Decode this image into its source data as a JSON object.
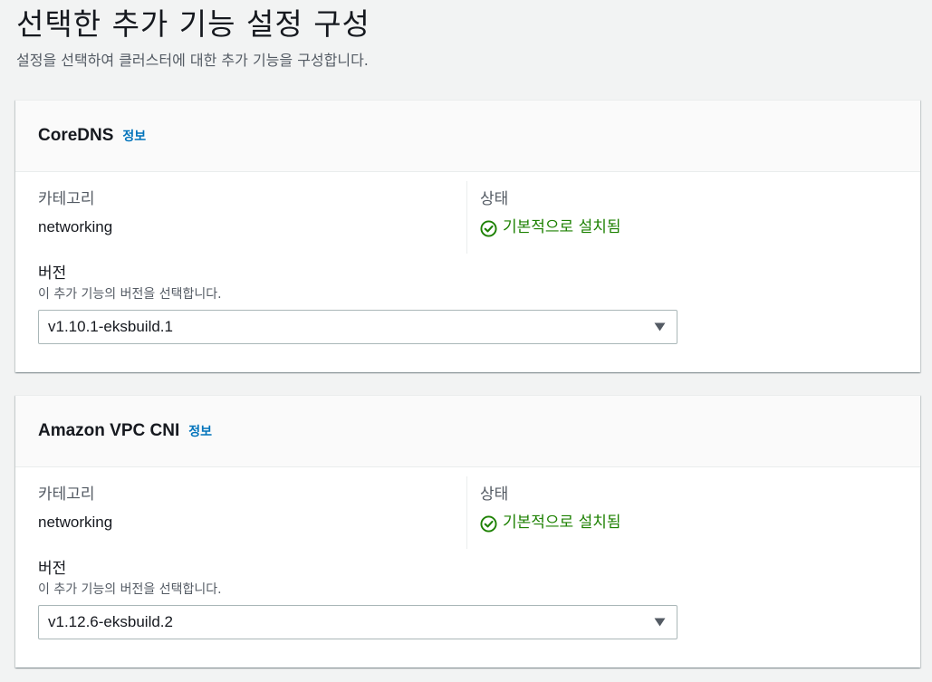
{
  "header": {
    "title": "선택한 추가 기능 설정 구성",
    "description": "설정을 선택하여 클러스터에 대한 추가 기능을 구성합니다."
  },
  "addons": [
    {
      "name": "CoreDNS",
      "info_link": "정보",
      "category_label": "카테고리",
      "category_value": "networking",
      "status_label": "상태",
      "status_value": "기본적으로 설치됨",
      "version_label": "버전",
      "version_description": "이 추가 기능의 버전을 선택합니다.",
      "version_selected": "v1.10.1-eksbuild.1"
    },
    {
      "name": "Amazon VPC CNI",
      "info_link": "정보",
      "category_label": "카테고리",
      "category_value": "networking",
      "status_label": "상태",
      "status_value": "기본적으로 설치됨",
      "version_label": "버전",
      "version_description": "이 추가 기능의 버전을 선택합니다.",
      "version_selected": "v1.12.6-eksbuild.2"
    }
  ],
  "colors": {
    "success": "#1d8102",
    "link": "#0073bb",
    "background": "#f2f3f3"
  },
  "icons": {
    "status": "check-circle-icon",
    "select": "caret-down-icon"
  }
}
